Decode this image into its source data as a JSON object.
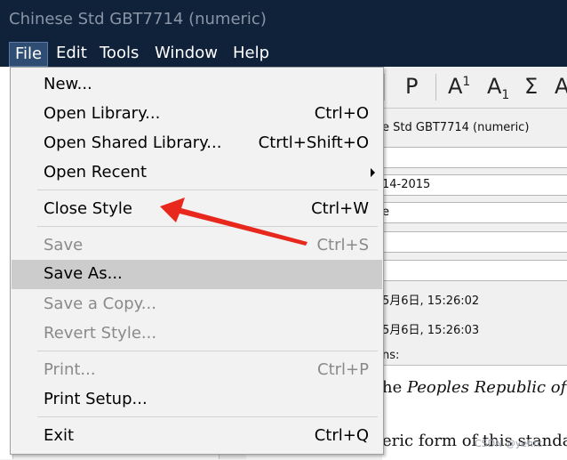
{
  "window": {
    "title": "Chinese Std GBT7714 (numeric)"
  },
  "menubar": {
    "items": [
      "File",
      "Edit",
      "Tools",
      "Window",
      "Help"
    ]
  },
  "toolbar": {
    "bold_p": "P",
    "superscript": "A",
    "superscript_mark": "1",
    "subscript": "A",
    "subscript_mark": "1",
    "sigma": "Σ",
    "more": "A"
  },
  "editor": {
    "style_name": "e Std GBT7714 (numeric)",
    "field_year": "14-2015",
    "field_e": "e",
    "created": "5月6日, 15:26:02",
    "modified": "5月6日, 15:26:03",
    "ns_label": "ns:",
    "preview_line1_prefix": "he ",
    "preview_line1_italic": "Peoples Republic of C",
    "preview_line2": "eric form of this standard"
  },
  "file_menu": {
    "new": "New...",
    "open_library": "Open Library...",
    "open_library_sc": "Ctrl+O",
    "open_shared": "Open Shared Library...",
    "open_shared_sc": "Ctrtl+Shift+O",
    "open_recent": "Open Recent",
    "close_style": "Close Style",
    "close_style_sc": "Ctrl+W",
    "save": "Save",
    "save_sc": "Ctrl+S",
    "save_as": "Save As...",
    "save_copy": "Save a Copy...",
    "revert": "Revert Style...",
    "print": "Print...",
    "print_sc": "Ctrl+P",
    "print_setup": "Print Setup...",
    "exit": "Exit",
    "exit_sc": "Ctrl+Q"
  },
  "watermark": "CSDN @yehrc",
  "colors": {
    "titlebar": "#10213a",
    "menu_bg": "#f2f2f2",
    "highlight": "#cccccc",
    "arrow": "#e8271d"
  }
}
